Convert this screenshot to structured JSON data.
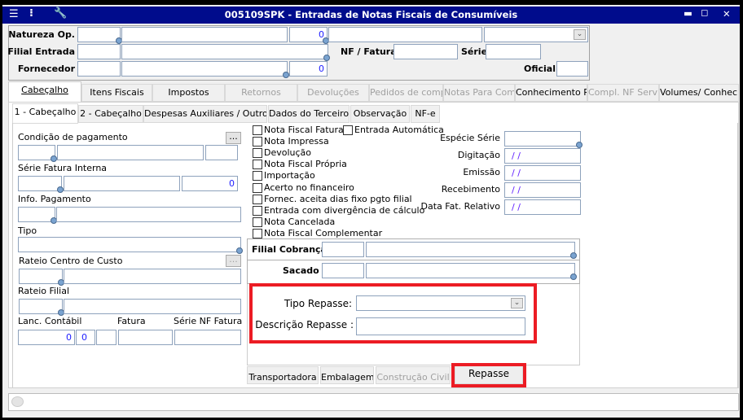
{
  "window": {
    "title": "005109SPK - Entradas de Notas Fiscais de Consumíveis",
    "icons": [
      "menu-icon",
      "traffic-light-icon",
      "wrench-icon"
    ],
    "controls": [
      "minimize-icon",
      "maximize-icon",
      "close-icon"
    ],
    "title_bg": "#000c8c"
  },
  "header": {
    "natureza_label": "Natureza Op.",
    "natureza_num": "0",
    "filial_label": "Filial Entrada",
    "nf_label": "NF / Fatura",
    "serie_label": "Série",
    "fornecedor_label": "Fornecedor",
    "fornecedor_num": "0",
    "oficial_label": "Oficial"
  },
  "tabs": [
    {
      "label": "Cabeçalho"
    },
    {
      "label": "Itens Fiscais"
    },
    {
      "label": "Impostos"
    },
    {
      "label": "Retornos"
    },
    {
      "label": "Devoluções"
    },
    {
      "label": "Pedidos de compr"
    },
    {
      "label": "Notas Para Comp"
    },
    {
      "label": "Conhecimento Re"
    },
    {
      "label": "Compl. NF Serviço"
    },
    {
      "label": "Volumes/ Conhecim"
    }
  ],
  "subtabs": [
    {
      "label": "1 - Cabeçalho"
    },
    {
      "label": "2 - Cabeçalho"
    },
    {
      "label": "Despesas Auxiliares / Outros"
    },
    {
      "label": "Dados do Terceiro"
    },
    {
      "label": "Observação"
    },
    {
      "label": "NF-e"
    }
  ],
  "left": {
    "condicao": "Condição de pagamento",
    "dots": "...",
    "serie_fatura": "Série Fatura Interna",
    "serie_num": "0",
    "info_pag": "Info. Pagamento",
    "tipo": "Tipo",
    "rateio_cc": "Rateio Centro de Custo",
    "rateio_filial": "Rateio Filial",
    "lanc": "Lanc. Contábil",
    "fatura": "Fatura",
    "serie_nf": "Série NF Fatura",
    "lanc_v1": "0",
    "lanc_v2": "0"
  },
  "checkboxes": [
    "Nota Fiscal Fatura",
    "Nota Impressa",
    "Devolução",
    "Nota Fiscal Própria",
    "Importação",
    "Acerto no financeiro",
    "Fornec. aceita dias fixo pgto filial",
    "Entrada com divergência de cálculo",
    "Nota Cancelada",
    "Nota Fiscal Complementar"
  ],
  "entrada_auto": "Entrada Automática",
  "right": {
    "especie": "Espécie Série",
    "digitacao": "Digitação",
    "emissao": "Emissão",
    "recebimento": "Recebimento",
    "data_fat": "Data Fat. Relativo",
    "date_empty": " / /"
  },
  "cobranca": {
    "filial": "Filial Cobrança",
    "sacado": "Sacado"
  },
  "repasse": {
    "tipo_label": "Tipo Repasse:",
    "desc_label": "Descrição Repasse :"
  },
  "bottom_tabs": [
    {
      "label": "Transportadora"
    },
    {
      "label": "Embalagem"
    },
    {
      "label": "Construção Civil"
    },
    {
      "label": "Repasse"
    }
  ],
  "highlight_color": "#ec1c24"
}
